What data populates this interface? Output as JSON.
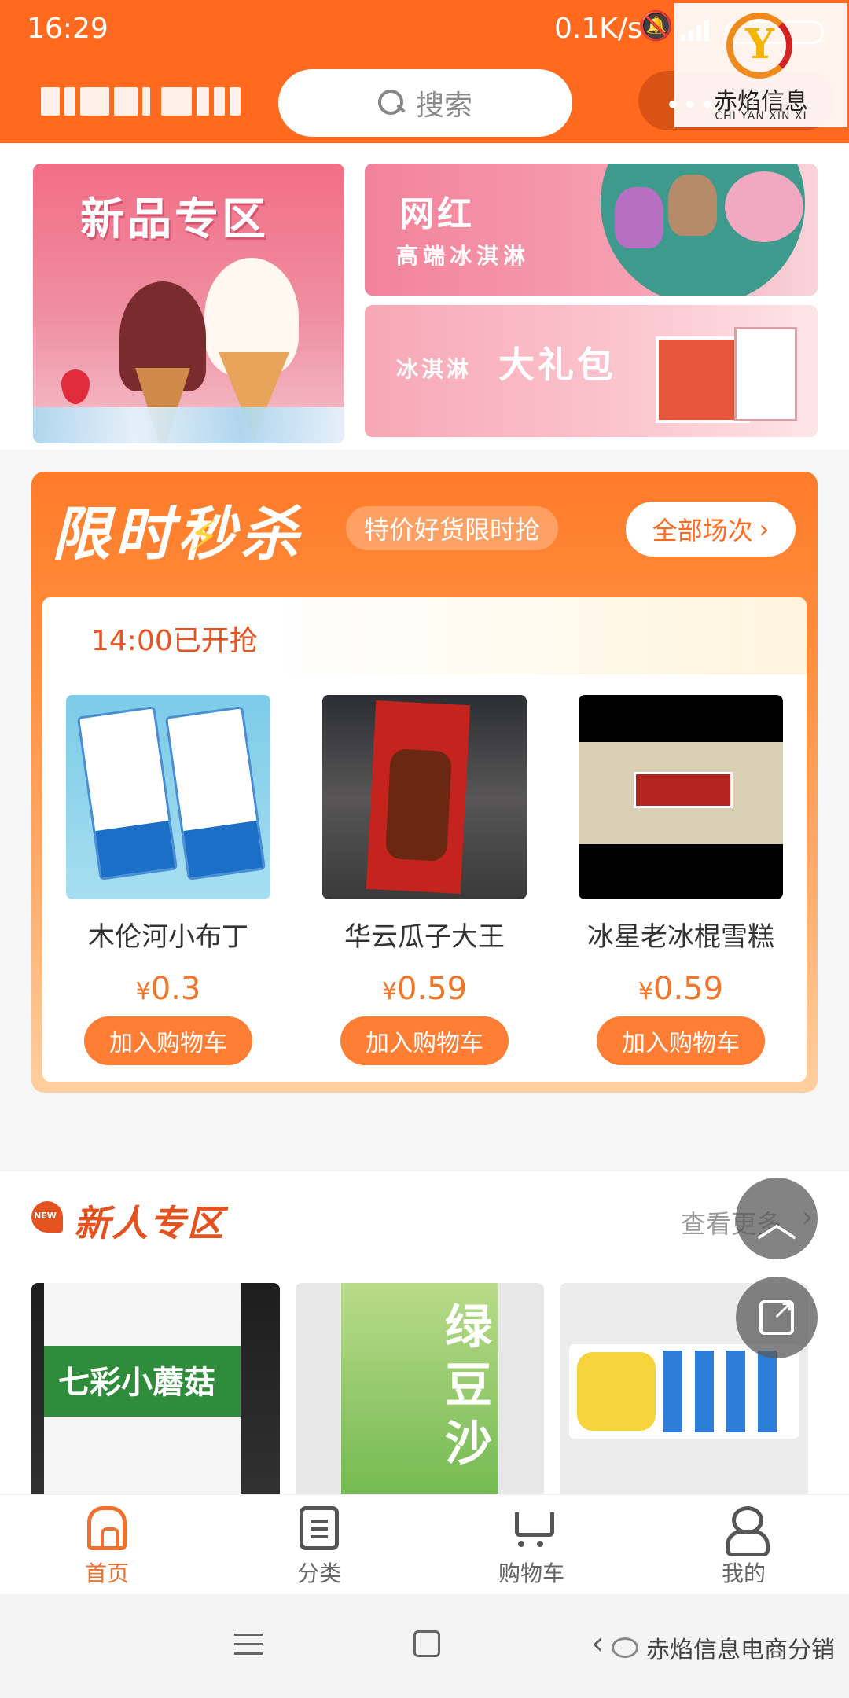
{
  "status_bar": {
    "time": "16:29",
    "net_speed": "0.1K/s",
    "mute_icon": "bell-off-icon"
  },
  "watermark": {
    "name": "赤焰信息",
    "subtitle": "CHI YAN XIN XI"
  },
  "search": {
    "placeholder": "搜索"
  },
  "menu": {
    "dots": "•••"
  },
  "banners": {
    "main_title": "新品专区",
    "top_title": "网红",
    "top_subtitle": "高端冰淇淋",
    "bottom_prefix": "冰淇淋",
    "bottom_title": "大礼包"
  },
  "flash_sale": {
    "title": "限时秒杀",
    "tagline": "特价好货限时抢",
    "all_sessions": "全部场次",
    "session": "14:00已开抢",
    "products": [
      {
        "name": "木伦河小布丁",
        "currency": "¥",
        "price": "0.3",
        "button": "加入购物车"
      },
      {
        "name": "华云瓜子大王",
        "currency": "¥",
        "price": "0.59",
        "button": "加入购物车"
      },
      {
        "name": "冰星老冰棍雪糕",
        "currency": "¥",
        "price": "0.59",
        "button": "加入购物车"
      }
    ]
  },
  "newcomer": {
    "title": "新人专区",
    "more": "查看更多",
    "items": [
      {
        "label": "七彩小蘑菇"
      },
      {
        "label": "绿豆沙"
      },
      {
        "label": ""
      }
    ]
  },
  "tabbar": [
    {
      "label": "首页",
      "icon": "home-icon",
      "active": true
    },
    {
      "label": "分类",
      "icon": "category-icon",
      "active": false
    },
    {
      "label": "购物车",
      "icon": "cart-icon",
      "active": false
    },
    {
      "label": "我的",
      "icon": "profile-icon",
      "active": false
    }
  ],
  "wechat_source": "赤焰信息电商分销",
  "colors": {
    "brand_orange": "#ff6a1f",
    "price": "#f2762a",
    "button": "#ff7e33"
  }
}
